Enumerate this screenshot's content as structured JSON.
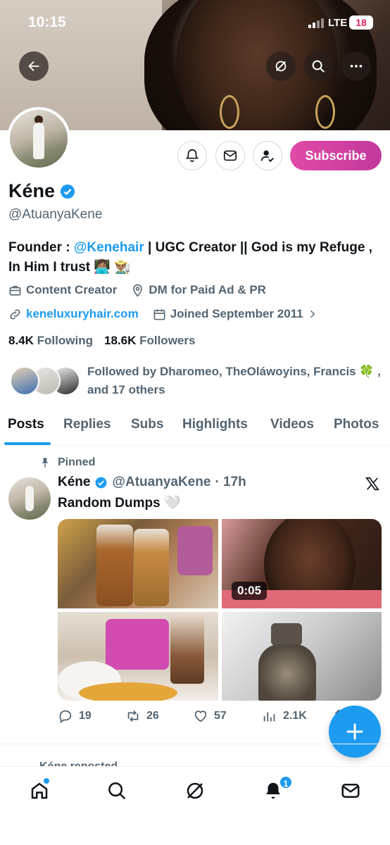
{
  "status_bar": {
    "time": "10:15",
    "network": "LTE",
    "battery": "18"
  },
  "profile": {
    "name": "Kéne",
    "handle": "@AtuanyaKene",
    "bio_prefix": "Founder : ",
    "bio_mention": "@Kenehair",
    "bio_suffix": " | UGC Creator || God is my Refuge , In Him I trust 👩🏽‍💻 👨🏽‍🌾",
    "category": "Content Creator",
    "location": "DM for Paid Ad & PR",
    "website": "keneluxuryhair.com",
    "joined": "Joined September 2011",
    "following_count": "8.4K",
    "following_label": "Following",
    "followers_count": "18.6K",
    "followers_label": "Followers",
    "followed_by": "Followed by Dharomeo, TheOláwoyins, Francis 🍀 , and 17 others"
  },
  "actions": {
    "subscribe_label": "Subscribe"
  },
  "tabs": [
    {
      "label": "Posts",
      "active": true
    },
    {
      "label": "Replies"
    },
    {
      "label": "Subs"
    },
    {
      "label": "Highlights"
    },
    {
      "label": "Videos"
    },
    {
      "label": "Photos"
    }
  ],
  "pinned_post": {
    "pinned_label": "Pinned",
    "author": "Kéne",
    "handle": "@AtuanyaKene",
    "time": "· 17h",
    "text": "Random Dumps 🤍",
    "video_duration": "0:05",
    "replies": "19",
    "reposts": "26",
    "likes": "57",
    "views": "2.1K"
  },
  "next_post_peek": "Kéne reposted",
  "nav": {
    "notifications_badge": "1"
  },
  "colors": {
    "accent": "#1d9bf0",
    "subscribe_gradient_start": "#e14aa6",
    "subscribe_gradient_end": "#c2389d"
  }
}
